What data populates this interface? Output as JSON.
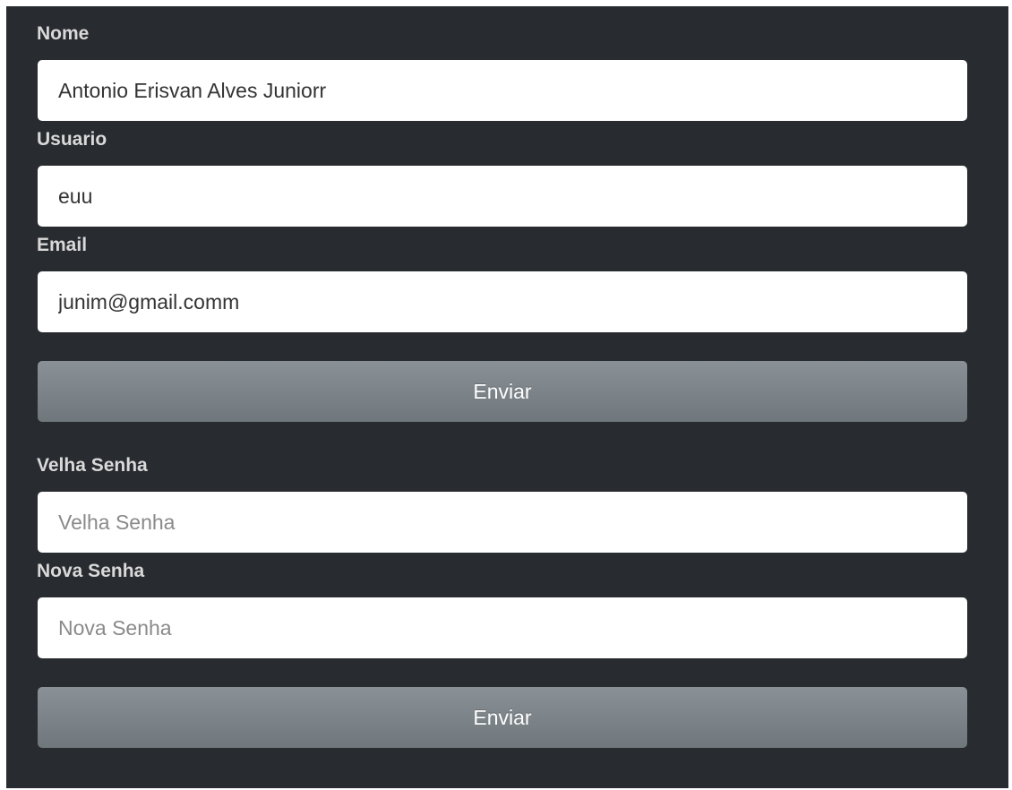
{
  "profile_form": {
    "name_label": "Nome",
    "name_value": "Antonio Erisvan Alves Juniorr",
    "user_label": "Usuario",
    "user_value": "euu",
    "email_label": "Email",
    "email_value": "junim@gmail.comm",
    "submit_label": "Enviar"
  },
  "password_form": {
    "old_label": "Velha Senha",
    "old_placeholder": "Velha Senha",
    "new_label": "Nova Senha",
    "new_placeholder": "Nova Senha",
    "submit_label": "Enviar"
  },
  "colors": {
    "background": "#282b30",
    "button": "#7d8489",
    "label": "#d9d9d9"
  }
}
